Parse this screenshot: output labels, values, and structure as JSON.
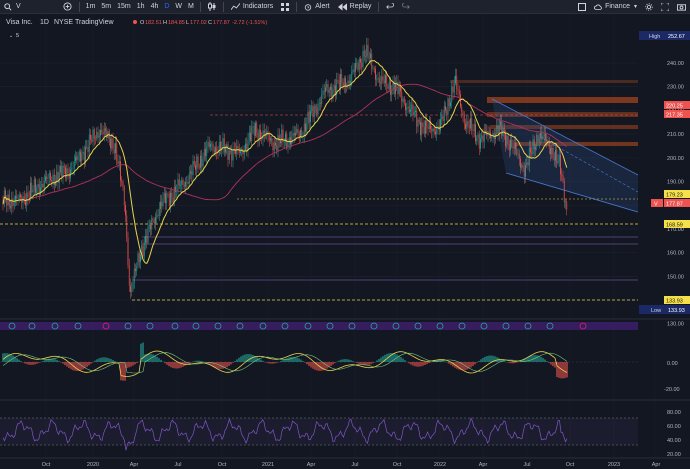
{
  "toolbar": {
    "symbol": "V",
    "intervals": [
      "1m",
      "5m",
      "15m",
      "1h",
      "4h",
      "D",
      "W",
      "M"
    ],
    "active_interval": "D",
    "indicators_label": "Indicators",
    "alert_label": "Alert",
    "replay_label": "Replay",
    "layout_name": "Finance"
  },
  "legend": {
    "title": "Visa Inc.",
    "interval": "1D",
    "exchange": "NYSE",
    "source": "TradingView",
    "o_label": "O",
    "o": "182.51",
    "h_label": "H",
    "h": "184.85",
    "l_label": "L",
    "l": "177.02",
    "c_label": "C",
    "c": "177.87",
    "change": "-2.72 (-1.51%)",
    "indicator_count": "5"
  },
  "price_axis": {
    "ticks": [
      "240.00",
      "230.00",
      "220.00",
      "210.00",
      "200.00",
      "190.00",
      "180.00",
      "170.00",
      "160.00",
      "150.00",
      "140.00",
      "130.00"
    ],
    "high_label": "High",
    "high_value": "252.67",
    "low_label": "Low",
    "low_value": "133.93",
    "level_220": "220.25",
    "level_217": "217.35",
    "level_179": "179.23",
    "last_symbol": "V",
    "last_price": "177.87",
    "level_168": "168.59",
    "level_133": "133.93"
  },
  "macd_axis": {
    "ticks": [
      "0.00",
      "-20.00"
    ]
  },
  "rsi_axis": {
    "ticks": [
      "80.00",
      "60.00",
      "40.00",
      "20.00"
    ]
  },
  "time_axis": {
    "labels": [
      "Oct",
      "2020",
      "Apr",
      "Jul",
      "Oct",
      "2021",
      "Apr",
      "Jul",
      "Oct",
      "2022",
      "Apr",
      "Jul",
      "Oct",
      "2023",
      "Apr"
    ]
  },
  "colors": {
    "background": "#131722",
    "up": "#26a69a",
    "down": "#ef5350",
    "ma_fast": "#e8d44d",
    "ma_slow": "#b2325a",
    "channel": "#4a7bd4",
    "rsi": "#7e57c2",
    "event_earnings": "#26a69a",
    "event_dividend": "#e91e63"
  }
}
